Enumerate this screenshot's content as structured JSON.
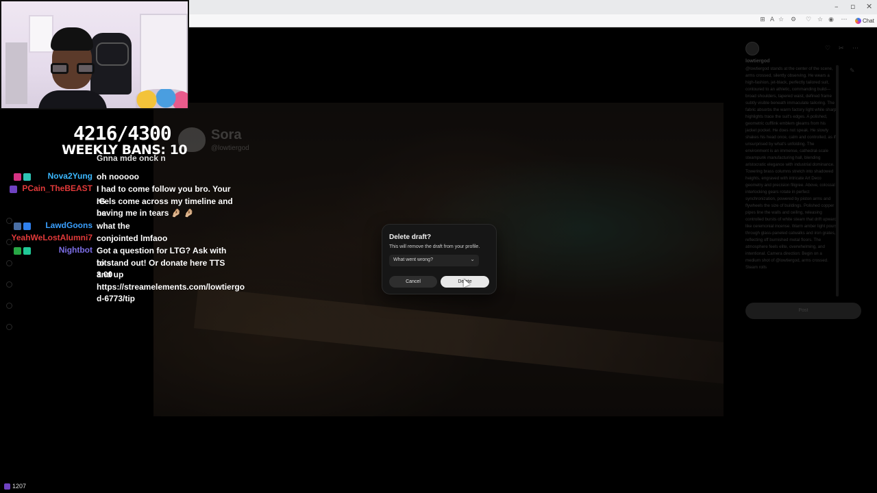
{
  "browser": {
    "chat_label": "Chat",
    "window_controls": [
      "–",
      "▫",
      "✕"
    ]
  },
  "stream": {
    "counter": "4216/4300",
    "weekly_bans": "WEEKLY BANS: 10",
    "viewer_count": "1207"
  },
  "chat": {
    "partial_top": "Gnna mde onck n",
    "messages": [
      {
        "user": "Nova2Yung",
        "color": "#3bb8ff",
        "badges": [
          "#d63384",
          "#2ec4b6"
        ],
        "lines": [
          "oh nooooo"
        ]
      },
      {
        "user": "PCain_TheBEAST",
        "color": "#e33a3a",
        "badges": [
          "#6f42c1"
        ],
        "lines": [
          "I had to come follow you bro. Your IG",
          "reels come across my timeline and be",
          "having me in tears 🤌🏼 🤌🏼"
        ]
      },
      {
        "user": "LawdGoons",
        "color": "#3aa0ff",
        "badges": [
          "#4a6fa5",
          "#2f80ed"
        ],
        "lines": [
          "what the"
        ]
      },
      {
        "user": "YeahWeLostAlumni7",
        "color": "#e33a3a",
        "badges": [],
        "lines": [
          "conjointed lmfaoo"
        ]
      },
      {
        "user": "Nightbot",
        "color": "#7c6ee6",
        "badges": [
          "#28a745",
          "#20c997"
        ],
        "lines": [
          "Got a question for LTG? Ask with bits",
          "to stand out! Or donate here TTS 3.00",
          "and up",
          "https://streamelements.com/lowtiergo",
          "d-6773/tip"
        ]
      }
    ]
  },
  "sora": {
    "brand": "Sora",
    "handle": "@lowtiergod",
    "username": "lowtiergod",
    "prompt_text": "@lowtiergod stands at the center of the scene, arms crossed, silently observing. He wears a high-fashion, jet-black, perfectly tailored suit, contoured to an athletic, commanding build—broad shoulders, tapered waist, defined frame subtly visible beneath immaculate tailoring. The fabric absorbs the warm factory light while sharp highlights trace the suit's edges. A polished, geometric cufflink emblem gleams from his jacket pocket. He does not speak. He slowly shakes his head once, calm and controlled, as if unsurprised by what's unfolding. The environment is an immense, cathedral-scale steampunk manufacturing hall, blending aristocratic elegance with industrial dominance. Towering brass columns stretch into shadowed heights, engraved with intricate Art Deco geometry and precision filigree. Above, colossal interlocking gears rotate in perfect synchronization, powered by piston arms and flywheels the size of buildings. Polished copper pipes line the walls and ceiling, releasing controlled bursts of white steam that drift upward like ceremonial incense. Warm amber light pours through glass-paneled catwalks and iron grates, reflecting off burnished metal floors. The atmosphere feels elite, overwhelming, and intentional. Camera direction: Begin on a medium shot of @lowtiergod, arms crossed. Steam rolls",
    "post_label": "Post"
  },
  "dialog": {
    "title": "Delete draft?",
    "subtitle": "This will remove the draft from your profile.",
    "select_value": "What went wrong?",
    "cancel_label": "Cancel",
    "delete_label": "Delete"
  }
}
